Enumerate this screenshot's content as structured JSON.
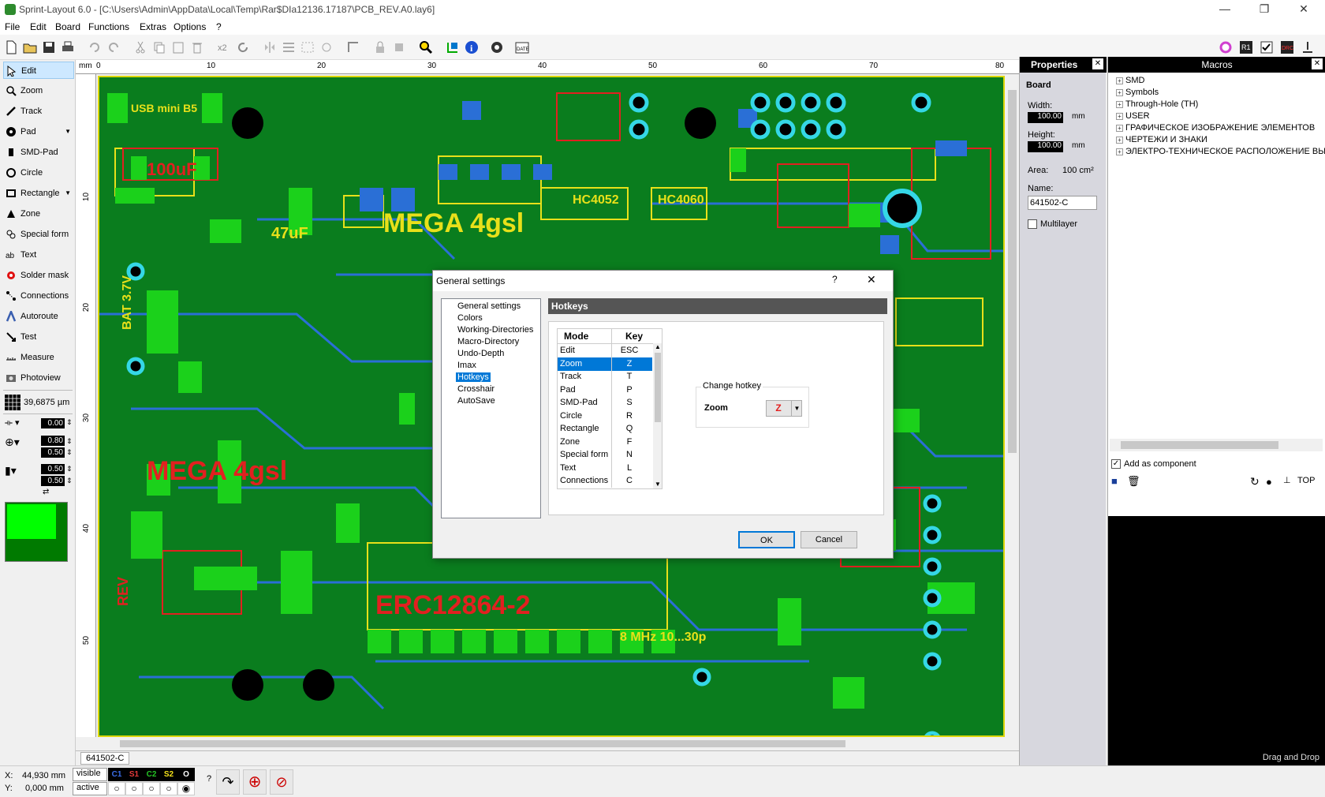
{
  "window": {
    "title": "Sprint-Layout 6.0 - [C:\\Users\\Admin\\AppData\\Local\\Temp\\Rar$DIa12136.17187\\PCB_REV.A0.lay6]",
    "minimize": "—",
    "maximize": "❐",
    "close": "✕"
  },
  "menu": [
    "File",
    "Edit",
    "Board",
    "Functions",
    "Extras",
    "Options",
    "?"
  ],
  "tools": [
    {
      "label": "Edit",
      "icon": "cursor-icon"
    },
    {
      "label": "Zoom",
      "icon": "zoom-icon"
    },
    {
      "label": "Track",
      "icon": "track-icon"
    },
    {
      "label": "Pad",
      "icon": "pad-icon"
    },
    {
      "label": "SMD-Pad",
      "icon": "smd-pad-icon"
    },
    {
      "label": "Circle",
      "icon": "circle-icon"
    },
    {
      "label": "Rectangle",
      "icon": "rectangle-icon"
    },
    {
      "label": "Zone",
      "icon": "zone-icon"
    },
    {
      "label": "Special form",
      "icon": "special-form-icon"
    },
    {
      "label": "Text",
      "icon": "text-icon"
    },
    {
      "label": "Solder mask",
      "icon": "solder-mask-icon"
    },
    {
      "label": "Connections",
      "icon": "connections-icon"
    },
    {
      "label": "Autoroute",
      "icon": "autoroute-icon"
    },
    {
      "label": "Test",
      "icon": "test-icon"
    },
    {
      "label": "Measure",
      "icon": "measure-icon"
    },
    {
      "label": "Photoview",
      "icon": "photoview-icon"
    }
  ],
  "grid": "39,6875 µm",
  "track_width": "0.00",
  "pad_outer": "0.80",
  "pad_inner": "0.50",
  "smd_w": "0.50",
  "smd_h": "0.50",
  "ruler": {
    "unit": "mm",
    "top": [
      "0",
      "10",
      "20",
      "30",
      "40",
      "50",
      "60",
      "70",
      "80"
    ],
    "left": [
      "10",
      "20",
      "30",
      "40",
      "50"
    ]
  },
  "properties": {
    "title": "Properties",
    "section": "Board",
    "width_label": "Width:",
    "width_value": "100.00",
    "height_label": "Height:",
    "height_value": "100.00",
    "unit": "mm",
    "area_label": "Area:",
    "area_value": "100 cm²",
    "name_label": "Name:",
    "name_value": "641502-C",
    "multilayer": "Multilayer"
  },
  "macros": {
    "title": "Macros",
    "tree": [
      "SMD",
      "Symbols",
      "Through-Hole (TH)",
      "USER",
      "ГРАФИЧЕСКОЕ ИЗОБРАЖЕНИЕ ЭЛЕМЕНТОВ",
      "ЧЕРТЕЖИ И ЗНАКИ",
      "ЭЛЕКТРО-ТЕХНИЧЕСКОЕ РАСПОЛОЖЕНИЕ ВЫВО"
    ],
    "add_as_component": "Add as component",
    "top_label": "TOP",
    "drag_drop": "Drag and Drop"
  },
  "board_tab": "641502-C",
  "status": {
    "x_label": "X:",
    "x_value": "44,930 mm",
    "y_label": "Y:",
    "y_value": "0,000 mm",
    "visible": "visible",
    "active": "active",
    "layers": [
      "C1",
      "S1",
      "C2",
      "S2",
      "O"
    ],
    "layer_colors": [
      "#3b6ee8",
      "#e83b3b",
      "#25c425",
      "#f5e11a",
      "#ffffff"
    ]
  },
  "dialog": {
    "title": "General settings",
    "help": "?",
    "close": "✕",
    "nav": [
      "General settings",
      "Colors",
      "Working-Directories",
      "Macro-Directory",
      "Undo-Depth",
      "Imax",
      "Hotkeys",
      "Crosshair",
      "AutoSave"
    ],
    "section_title": "Hotkeys",
    "col_mode": "Mode",
    "col_key": "Key",
    "hotkeys": [
      {
        "mode": "Edit",
        "key": "ESC"
      },
      {
        "mode": "Zoom",
        "key": "Z"
      },
      {
        "mode": "Track",
        "key": "T"
      },
      {
        "mode": "Pad",
        "key": "P"
      },
      {
        "mode": "SMD-Pad",
        "key": "S"
      },
      {
        "mode": "Circle",
        "key": "R"
      },
      {
        "mode": "Rectangle",
        "key": "Q"
      },
      {
        "mode": "Zone",
        "key": "F"
      },
      {
        "mode": "Special form",
        "key": "N"
      },
      {
        "mode": "Text",
        "key": "L"
      },
      {
        "mode": "Connections",
        "key": "C"
      }
    ],
    "change_title": "Change hotkey",
    "change_mode": "Zoom",
    "change_key": "Z",
    "ok": "OK",
    "cancel": "Cancel"
  },
  "pcb_labels": {
    "mega": "MEGA 4gsl",
    "mega2": "MEGA 4gsl",
    "erc": "ERC12864-2",
    "usb": "USB mini B5",
    "cap": "100uF",
    "cap2": "47uF",
    "hc4052": "HC4052",
    "hc4060": "HC4060",
    "bat": "BAT 3.7V",
    "mhz": "8 MHz 10...30p",
    "rev": "REV"
  }
}
